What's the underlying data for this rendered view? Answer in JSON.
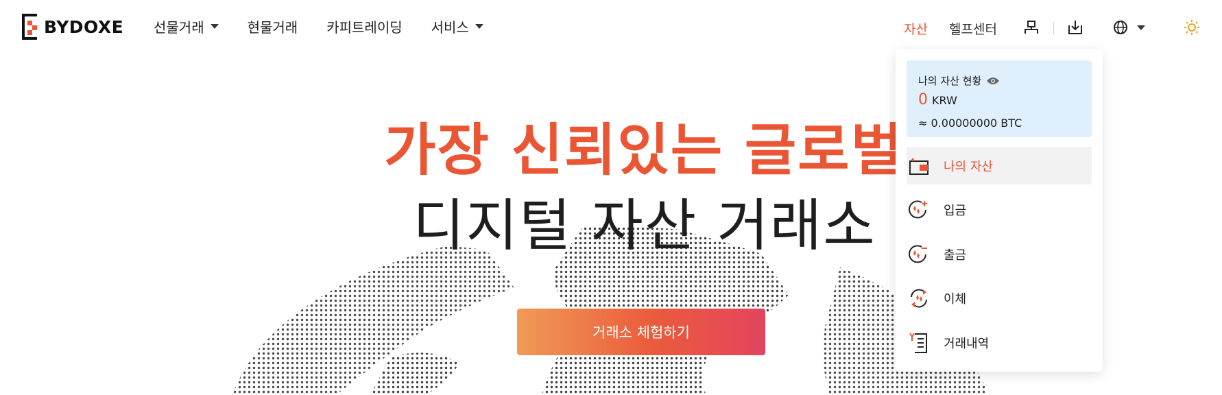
{
  "brand": {
    "name": "BYDOXE",
    "accent": "#ea5534"
  },
  "nav": {
    "items": [
      {
        "label": "선물거래",
        "has_dropdown": true
      },
      {
        "label": "현물거래",
        "has_dropdown": false
      },
      {
        "label": "카피트레이딩",
        "has_dropdown": false
      },
      {
        "label": "서비스",
        "has_dropdown": true
      }
    ]
  },
  "right_nav": {
    "assets_label": "자산",
    "help_label": "헬프센터",
    "icons": [
      "user-icon",
      "download-icon",
      "globe-icon",
      "sun-icon"
    ]
  },
  "hero": {
    "headline_accent": "가장 신뢰있는 글로벌",
    "headline_main": "디지털 자산 거래소",
    "cta_label": "거래소 체험하기"
  },
  "asset_dropdown": {
    "title": "나의 자산 현황",
    "amount": "0",
    "currency": "KRW",
    "btc_equivalent": "≈ 0.00000000 BTC",
    "items": [
      {
        "label": "나의 자산",
        "icon": "wallet-icon",
        "active": true
      },
      {
        "label": "입금",
        "icon": "deposit-icon",
        "active": false
      },
      {
        "label": "출금",
        "icon": "withdraw-icon",
        "active": false
      },
      {
        "label": "이체",
        "icon": "transfer-icon",
        "active": false
      },
      {
        "label": "거래내역",
        "icon": "history-icon",
        "active": false
      }
    ]
  }
}
